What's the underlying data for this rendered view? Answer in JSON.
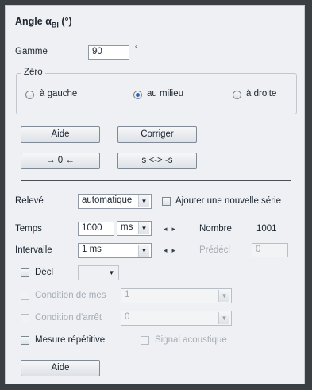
{
  "title": {
    "main": "Angle α",
    "sub": "BI",
    "unit": "(°)"
  },
  "gamme": {
    "label": "Gamme",
    "value": "90",
    "unit": "°"
  },
  "zero": {
    "legend": "Zéro",
    "options": [
      {
        "label": "à gauche",
        "selected": false
      },
      {
        "label": "au milieu",
        "selected": true
      },
      {
        "label": "à droite",
        "selected": false
      }
    ]
  },
  "buttons": {
    "aide_top": "Aide",
    "corriger": "Corriger",
    "arrow_zero": "→ 0 ←",
    "swap_sign": "s <-> -s",
    "aide_bottom": "Aide"
  },
  "releve": {
    "label": "Relevé",
    "value": "automatique",
    "ajouter_label": "Ajouter une nouvelle série"
  },
  "temps": {
    "label": "Temps",
    "value": "1000",
    "unit": "ms",
    "nombre_label": "Nombre",
    "nombre_value": "1001"
  },
  "intervalle": {
    "label": "Intervalle",
    "value": "1 ms",
    "predecl_label": "Prédécl",
    "predecl_value": "0"
  },
  "decl": {
    "label": "Décl",
    "value": ""
  },
  "condition_mes": {
    "label": "Condition de mes",
    "value": "1"
  },
  "condition_arret": {
    "label": "Condition d'arrêt",
    "value": "0"
  },
  "mesure_repetitive": {
    "label": "Mesure répétitive"
  },
  "signal_acoustique": {
    "label": "Signal acoustique"
  }
}
